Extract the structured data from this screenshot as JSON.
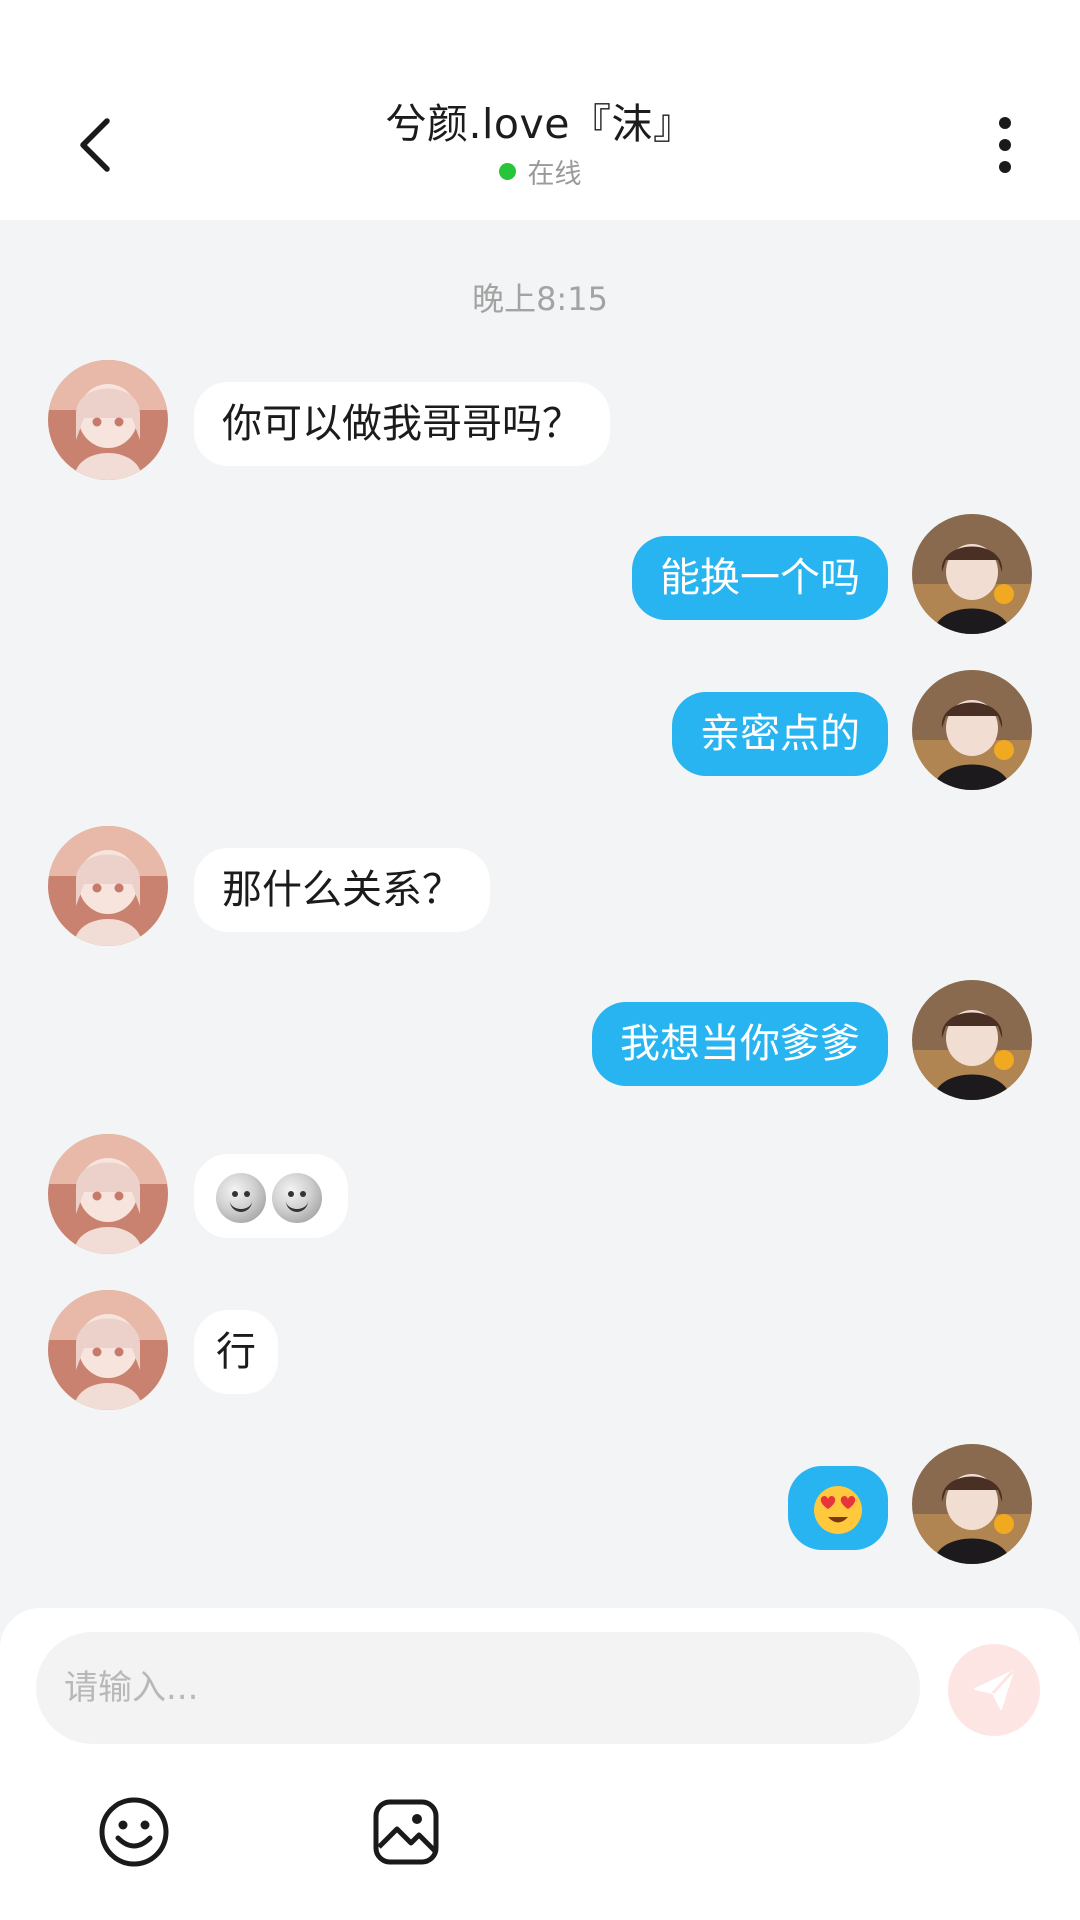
{
  "header": {
    "title": "兮颜.love『沫』",
    "status_text": "在线",
    "status_color": "#25c639",
    "back_icon": "chevron-left-icon",
    "more_icon": "more-vertical-icon"
  },
  "chat": {
    "timestamp": "晚上8:15",
    "messages": [
      {
        "side": "in",
        "text": "你可以做我哥哥吗？"
      },
      {
        "side": "out",
        "text": "能换一个吗"
      },
      {
        "side": "out",
        "text": "亲密点的"
      },
      {
        "side": "in",
        "text": "那什么关系？"
      },
      {
        "side": "out",
        "text": "我想当你爹爹"
      },
      {
        "side": "in",
        "text": "",
        "emoji": "moon-face-emoji x2"
      },
      {
        "side": "in",
        "text": "行"
      },
      {
        "side": "out",
        "text": "",
        "emoji": "heart-eyes-emoji"
      }
    ]
  },
  "input": {
    "placeholder": "请输入...",
    "send_icon": "send-icon",
    "emoji_icon": "smiley-icon",
    "image_icon": "image-icon"
  },
  "colors": {
    "accent": "#27b4f0",
    "background": "#f2f4f5",
    "send_button": "#fde5e3"
  }
}
